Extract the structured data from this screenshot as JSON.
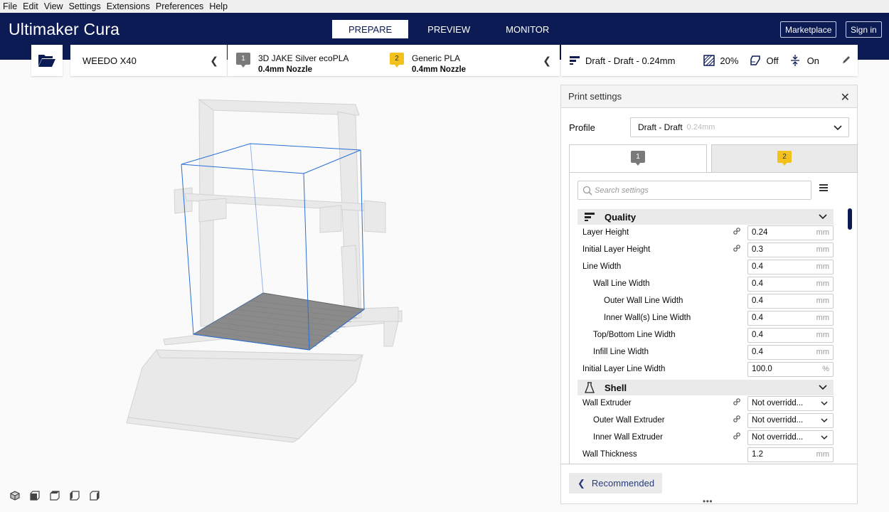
{
  "menu": [
    "File",
    "Edit",
    "View",
    "Settings",
    "Extensions",
    "Preferences",
    "Help"
  ],
  "app": {
    "logo_light": "Ultimaker",
    "logo_name": "Cura"
  },
  "stages": [
    {
      "label": "PREPARE",
      "active": true
    },
    {
      "label": "PREVIEW",
      "active": false
    },
    {
      "label": "MONITOR",
      "active": false
    }
  ],
  "header_buttons": {
    "marketplace": "Marketplace",
    "signin": "Sign in"
  },
  "toolbar": {
    "open_icon": "folder-open-icon",
    "machine": "WEEDO X40",
    "extruders": [
      {
        "number": "1",
        "material": "3D JAKE Silver ecoPLA",
        "nozzle": "0.4mm Nozzle",
        "color": "#7a7a7a"
      },
      {
        "number": "2",
        "material": "Generic PLA",
        "nozzle": "0.4mm Nozzle",
        "color": "#f3c11d"
      }
    ],
    "print_setup": {
      "profile": "Draft - Draft - 0.24mm",
      "infill": "20%",
      "support": "Off",
      "adhesion": "On"
    }
  },
  "panel": {
    "title": "Print settings",
    "profile_label": "Profile",
    "profile_value": "Draft - Draft",
    "profile_sub": "0.24mm",
    "extruder_tabs": [
      {
        "number": "1",
        "color": "#7a7a7a"
      },
      {
        "number": "2",
        "color": "#f3c11d"
      }
    ],
    "search_placeholder": "Search settings",
    "categories": [
      {
        "name": "Quality",
        "icon": "quality-icon"
      },
      {
        "name": "Shell",
        "icon": "shell-icon"
      }
    ],
    "quality_rows": [
      {
        "label": "Layer Height",
        "value": "0.24",
        "unit": "mm",
        "indent": 0,
        "linked": true
      },
      {
        "label": "Initial Layer Height",
        "value": "0.3",
        "unit": "mm",
        "indent": 0,
        "linked": true
      },
      {
        "label": "Line Width",
        "value": "0.4",
        "unit": "mm",
        "indent": 0,
        "linked": false
      },
      {
        "label": "Wall Line Width",
        "value": "0.4",
        "unit": "mm",
        "indent": 1,
        "linked": false
      },
      {
        "label": "Outer Wall Line Width",
        "value": "0.4",
        "unit": "mm",
        "indent": 2,
        "linked": false
      },
      {
        "label": "Inner Wall(s) Line Width",
        "value": "0.4",
        "unit": "mm",
        "indent": 2,
        "linked": false
      },
      {
        "label": "Top/Bottom Line Width",
        "value": "0.4",
        "unit": "mm",
        "indent": 1,
        "linked": false
      },
      {
        "label": "Infill Line Width",
        "value": "0.4",
        "unit": "mm",
        "indent": 1,
        "linked": false
      },
      {
        "label": "Initial Layer Line Width",
        "value": "100.0",
        "unit": "%",
        "indent": 0,
        "linked": false
      }
    ],
    "shell_rows": [
      {
        "label": "Wall Extruder",
        "value": "Not overridd...",
        "indent": 0,
        "linked": true,
        "dropdown": true
      },
      {
        "label": "Outer Wall Extruder",
        "value": "Not overridd...",
        "indent": 1,
        "linked": true,
        "dropdown": true
      },
      {
        "label": "Inner Wall Extruder",
        "value": "Not overridd...",
        "indent": 1,
        "linked": true,
        "dropdown": true
      },
      {
        "label": "Wall Thickness",
        "value": "1.2",
        "unit": "mm",
        "indent": 0,
        "linked": false
      }
    ],
    "recommended_label": "Recommended",
    "drag_handle": "•••"
  },
  "view_buttons": [
    "3d-view-icon",
    "front-view-icon",
    "top-view-icon",
    "left-view-icon",
    "right-view-icon"
  ]
}
